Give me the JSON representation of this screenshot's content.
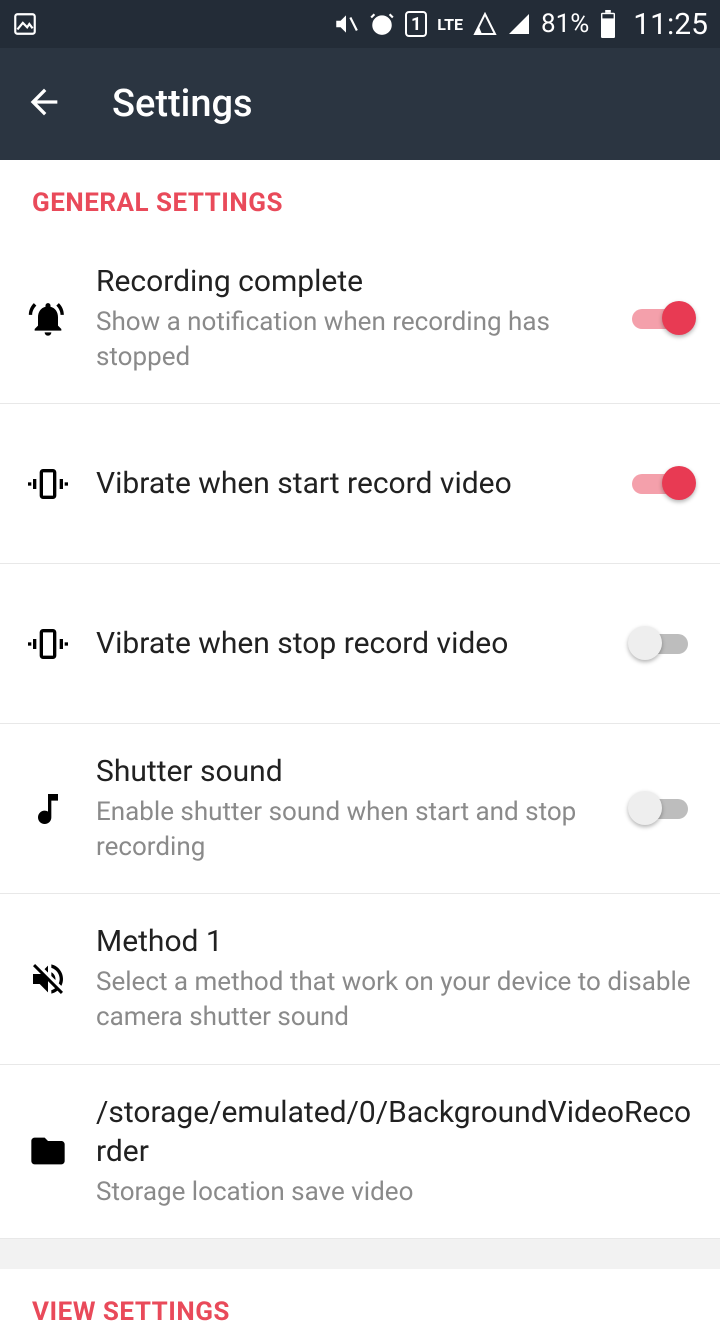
{
  "status": {
    "battery": "81%",
    "time": "11:25",
    "network": "LTE",
    "sim": "1"
  },
  "appbar": {
    "title": "Settings"
  },
  "sections": {
    "general": {
      "header": "GENERAL SETTINGS",
      "items": [
        {
          "title": "Recording complete",
          "subtitle": "Show a notification when recording has stopped",
          "toggle": true
        },
        {
          "title": "Vibrate when start record video",
          "subtitle": "",
          "toggle": true
        },
        {
          "title": "Vibrate when stop record video",
          "subtitle": "",
          "toggle": false
        },
        {
          "title": "Shutter sound",
          "subtitle": "Enable shutter sound when start and stop recording",
          "toggle": false
        },
        {
          "title": "Method 1",
          "subtitle": "Select a method that work on your device to disable camera shutter sound"
        },
        {
          "title": "/storage/emulated/0/BackgroundVideoRecorder",
          "subtitle": "Storage location save video"
        }
      ]
    },
    "view": {
      "header": "VIEW SETTINGS"
    }
  }
}
